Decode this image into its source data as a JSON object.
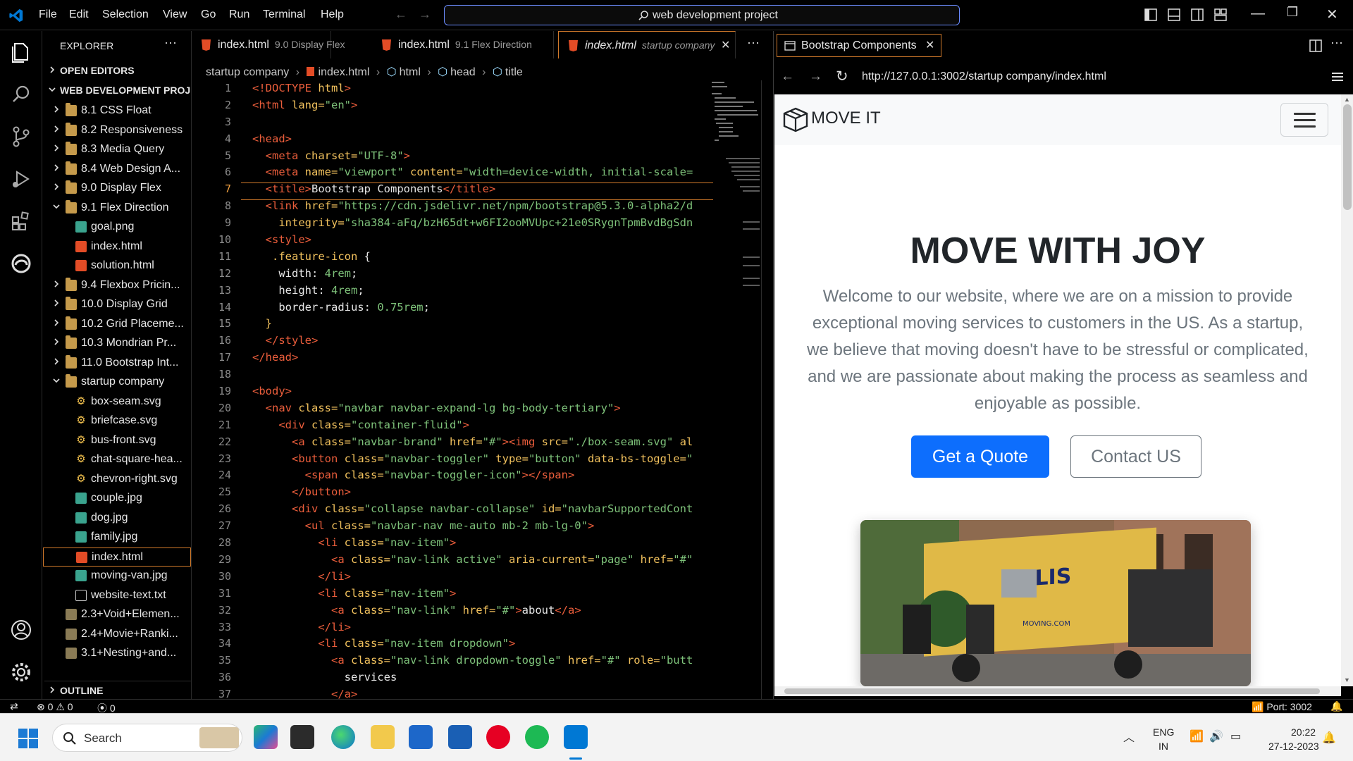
{
  "menu": [
    "File",
    "Edit",
    "Selection",
    "View",
    "Go",
    "Run",
    "Terminal",
    "Help"
  ],
  "search_box": "web development project",
  "explorer": {
    "title": "EXPLORER",
    "open_editors": "OPEN EDITORS",
    "workspace": "WEB DEVELOPMENT PROJ...",
    "outline": "OUTLINE",
    "items": [
      {
        "label": "8.1 CSS Float",
        "type": "folder",
        "state": "closed",
        "depth": 1
      },
      {
        "label": "8.2 Responsiveness",
        "type": "folder",
        "state": "closed",
        "depth": 1
      },
      {
        "label": "8.3 Media Query",
        "type": "folder",
        "state": "closed",
        "depth": 1
      },
      {
        "label": "8.4 Web Design A...",
        "type": "folder",
        "state": "closed",
        "depth": 1
      },
      {
        "label": "9.0 Display Flex",
        "type": "folder",
        "state": "closed",
        "depth": 1
      },
      {
        "label": "9.1 Flex Direction",
        "type": "folder",
        "state": "open",
        "depth": 1
      },
      {
        "label": "goal.png",
        "type": "image",
        "depth": 2
      },
      {
        "label": "index.html",
        "type": "html",
        "depth": 2
      },
      {
        "label": "solution.html",
        "type": "html",
        "depth": 2
      },
      {
        "label": "9.4 Flexbox Pricin...",
        "type": "folder",
        "state": "closed",
        "depth": 1
      },
      {
        "label": "10.0 Display Grid",
        "type": "folder",
        "state": "closed",
        "depth": 1
      },
      {
        "label": "10.2 Grid Placeme...",
        "type": "folder",
        "state": "closed",
        "depth": 1
      },
      {
        "label": "10.3 Mondrian Pr...",
        "type": "folder",
        "state": "closed",
        "depth": 1
      },
      {
        "label": "11.0 Bootstrap Int...",
        "type": "folder",
        "state": "closed",
        "depth": 1
      },
      {
        "label": "startup company",
        "type": "folder",
        "state": "open",
        "depth": 1
      },
      {
        "label": "box-seam.svg",
        "type": "svg",
        "depth": 2
      },
      {
        "label": "briefcase.svg",
        "type": "svg",
        "depth": 2
      },
      {
        "label": "bus-front.svg",
        "type": "svg",
        "depth": 2
      },
      {
        "label": "chat-square-hea...",
        "type": "svg",
        "depth": 2
      },
      {
        "label": "chevron-right.svg",
        "type": "svg",
        "depth": 2
      },
      {
        "label": "couple.jpg",
        "type": "image",
        "depth": 2
      },
      {
        "label": "dog.jpg",
        "type": "image",
        "depth": 2
      },
      {
        "label": "family.jpg",
        "type": "image",
        "depth": 2
      },
      {
        "label": "index.html",
        "type": "html",
        "depth": 2,
        "selected": true
      },
      {
        "label": "moving-van.jpg",
        "type": "image",
        "depth": 2
      },
      {
        "label": "website-text.txt",
        "type": "txt",
        "depth": 2
      },
      {
        "label": "2.3+Void+Elemen...",
        "type": "zip",
        "depth": 1
      },
      {
        "label": "2.4+Movie+Ranki...",
        "type": "zip",
        "depth": 1
      },
      {
        "label": "3.1+Nesting+and...",
        "type": "zip",
        "depth": 1
      }
    ]
  },
  "tabs": [
    {
      "name": "index.html",
      "desc": "9.0 Display Flex"
    },
    {
      "name": "index.html",
      "desc": "9.1 Flex Direction"
    },
    {
      "name": "index.html",
      "desc": "startup company",
      "active": true
    }
  ],
  "breadcrumb": [
    "startup company",
    "index.html",
    "html",
    "head",
    "title"
  ],
  "line_numbers": [
    "1",
    "2",
    "3",
    "4",
    "5",
    "6",
    "7",
    "8",
    "9",
    "10",
    "11",
    "12",
    "13",
    "14",
    "15",
    "16",
    "17",
    "18",
    "19",
    "20",
    "21",
    "22",
    "23",
    "24",
    "25",
    "26",
    "27",
    "28",
    "29",
    "30",
    "31",
    "32",
    "33",
    "34",
    "35",
    "36",
    "37"
  ],
  "code_lines": [
    [
      {
        "c": "t",
        "v": "<!DOCTYPE "
      },
      {
        "c": "a",
        "v": "html"
      },
      {
        "c": "t",
        "v": ">"
      }
    ],
    [
      {
        "c": "t",
        "v": "<html "
      },
      {
        "c": "a",
        "v": "lang="
      },
      {
        "c": "s",
        "v": "\"en\""
      },
      {
        "c": "t",
        "v": ">"
      }
    ],
    [],
    [
      {
        "c": "t",
        "v": "<head>"
      }
    ],
    [
      {
        "c": "n",
        "v": "  "
      },
      {
        "c": "t",
        "v": "<meta "
      },
      {
        "c": "a",
        "v": "charset="
      },
      {
        "c": "s",
        "v": "\"UTF-8\""
      },
      {
        "c": "t",
        "v": ">"
      }
    ],
    [
      {
        "c": "n",
        "v": "  "
      },
      {
        "c": "t",
        "v": "<meta "
      },
      {
        "c": "a",
        "v": "name="
      },
      {
        "c": "s",
        "v": "\"viewport\""
      },
      {
        "c": "a",
        "v": " content="
      },
      {
        "c": "s",
        "v": "\"width=device-width, initial-scale="
      }
    ],
    [
      {
        "c": "n",
        "v": "  "
      },
      {
        "c": "t",
        "v": "<title>"
      },
      {
        "c": "n",
        "v": "Bootstrap Components"
      },
      {
        "c": "t",
        "v": "</title>"
      }
    ],
    [
      {
        "c": "n",
        "v": "  "
      },
      {
        "c": "t",
        "v": "<link "
      },
      {
        "c": "a",
        "v": "href="
      },
      {
        "c": "s",
        "v": "\"https://cdn.jsdelivr.net/npm/bootstrap@5.3.0-alpha2/d"
      }
    ],
    [
      {
        "c": "n",
        "v": "    "
      },
      {
        "c": "a",
        "v": "integrity="
      },
      {
        "c": "s",
        "v": "\"sha384-aFq/bzH65dt+w6FI2ooMVUpc+21e0SRygnTpmBvdBgSdn"
      }
    ],
    [
      {
        "c": "n",
        "v": "  "
      },
      {
        "c": "t",
        "v": "<style>"
      }
    ],
    [
      {
        "c": "n",
        "v": "   "
      },
      {
        "c": "a",
        "v": ".feature-icon "
      },
      {
        "c": "n",
        "v": "{"
      }
    ],
    [
      {
        "c": "n",
        "v": "    width: "
      },
      {
        "c": "s",
        "v": "4rem"
      },
      {
        "c": "n",
        "v": ";"
      }
    ],
    [
      {
        "c": "n",
        "v": "    height: "
      },
      {
        "c": "s",
        "v": "4rem"
      },
      {
        "c": "n",
        "v": ";"
      }
    ],
    [
      {
        "c": "n",
        "v": "    border-radius: "
      },
      {
        "c": "s",
        "v": "0.75rem"
      },
      {
        "c": "n",
        "v": ";"
      }
    ],
    [
      {
        "c": "a",
        "v": "  }"
      }
    ],
    [
      {
        "c": "n",
        "v": "  "
      },
      {
        "c": "t",
        "v": "</style>"
      }
    ],
    [
      {
        "c": "t",
        "v": "</head>"
      }
    ],
    [],
    [
      {
        "c": "t",
        "v": "<body>"
      }
    ],
    [
      {
        "c": "n",
        "v": "  "
      },
      {
        "c": "t",
        "v": "<nav "
      },
      {
        "c": "a",
        "v": "class="
      },
      {
        "c": "s",
        "v": "\"navbar navbar-expand-lg bg-body-tertiary\""
      },
      {
        "c": "t",
        "v": ">"
      }
    ],
    [
      {
        "c": "n",
        "v": "    "
      },
      {
        "c": "t",
        "v": "<div "
      },
      {
        "c": "a",
        "v": "class="
      },
      {
        "c": "s",
        "v": "\"container-fluid\""
      },
      {
        "c": "t",
        "v": ">"
      }
    ],
    [
      {
        "c": "n",
        "v": "      "
      },
      {
        "c": "t",
        "v": "<a "
      },
      {
        "c": "a",
        "v": "class="
      },
      {
        "c": "s",
        "v": "\"navbar-brand\""
      },
      {
        "c": "a",
        "v": " href="
      },
      {
        "c": "s",
        "v": "\"#\""
      },
      {
        "c": "t",
        "v": "><img "
      },
      {
        "c": "a",
        "v": "src="
      },
      {
        "c": "s",
        "v": "\"./box-seam.svg\""
      },
      {
        "c": "a",
        "v": " al"
      }
    ],
    [
      {
        "c": "n",
        "v": "      "
      },
      {
        "c": "t",
        "v": "<button "
      },
      {
        "c": "a",
        "v": "class="
      },
      {
        "c": "s",
        "v": "\"navbar-toggler\""
      },
      {
        "c": "a",
        "v": " type="
      },
      {
        "c": "s",
        "v": "\"button\""
      },
      {
        "c": "a",
        "v": " data-bs-toggle="
      },
      {
        "c": "s",
        "v": "\""
      }
    ],
    [
      {
        "c": "n",
        "v": "        "
      },
      {
        "c": "t",
        "v": "<span "
      },
      {
        "c": "a",
        "v": "class="
      },
      {
        "c": "s",
        "v": "\"navbar-toggler-icon\""
      },
      {
        "c": "t",
        "v": "></span>"
      }
    ],
    [
      {
        "c": "n",
        "v": "      "
      },
      {
        "c": "t",
        "v": "</button>"
      }
    ],
    [
      {
        "c": "n",
        "v": "      "
      },
      {
        "c": "t",
        "v": "<div "
      },
      {
        "c": "a",
        "v": "class="
      },
      {
        "c": "s",
        "v": "\"collapse navbar-collapse\""
      },
      {
        "c": "a",
        "v": " id="
      },
      {
        "c": "s",
        "v": "\"navbarSupportedCont"
      }
    ],
    [
      {
        "c": "n",
        "v": "        "
      },
      {
        "c": "t",
        "v": "<ul "
      },
      {
        "c": "a",
        "v": "class="
      },
      {
        "c": "s",
        "v": "\"navbar-nav me-auto mb-2 mb-lg-0\""
      },
      {
        "c": "t",
        "v": ">"
      }
    ],
    [
      {
        "c": "n",
        "v": "          "
      },
      {
        "c": "t",
        "v": "<li "
      },
      {
        "c": "a",
        "v": "class="
      },
      {
        "c": "s",
        "v": "\"nav-item\""
      },
      {
        "c": "t",
        "v": ">"
      }
    ],
    [
      {
        "c": "n",
        "v": "            "
      },
      {
        "c": "t",
        "v": "<a "
      },
      {
        "c": "a",
        "v": "class="
      },
      {
        "c": "s",
        "v": "\"nav-link active\""
      },
      {
        "c": "a",
        "v": " aria-current="
      },
      {
        "c": "s",
        "v": "\"page\""
      },
      {
        "c": "a",
        "v": " href="
      },
      {
        "c": "s",
        "v": "\"#\""
      }
    ],
    [
      {
        "c": "n",
        "v": "          "
      },
      {
        "c": "t",
        "v": "</li>"
      }
    ],
    [
      {
        "c": "n",
        "v": "          "
      },
      {
        "c": "t",
        "v": "<li "
      },
      {
        "c": "a",
        "v": "class="
      },
      {
        "c": "s",
        "v": "\"nav-item\""
      },
      {
        "c": "t",
        "v": ">"
      }
    ],
    [
      {
        "c": "n",
        "v": "            "
      },
      {
        "c": "t",
        "v": "<a "
      },
      {
        "c": "a",
        "v": "class="
      },
      {
        "c": "s",
        "v": "\"nav-link\""
      },
      {
        "c": "a",
        "v": " href="
      },
      {
        "c": "s",
        "v": "\"#\""
      },
      {
        "c": "t",
        "v": ">"
      },
      {
        "c": "n",
        "v": "about"
      },
      {
        "c": "t",
        "v": "</a>"
      }
    ],
    [
      {
        "c": "n",
        "v": "          "
      },
      {
        "c": "t",
        "v": "</li>"
      }
    ],
    [
      {
        "c": "n",
        "v": "          "
      },
      {
        "c": "t",
        "v": "<li "
      },
      {
        "c": "a",
        "v": "class="
      },
      {
        "c": "s",
        "v": "\"nav-item dropdown\""
      },
      {
        "c": "t",
        "v": ">"
      }
    ],
    [
      {
        "c": "n",
        "v": "            "
      },
      {
        "c": "t",
        "v": "<a "
      },
      {
        "c": "a",
        "v": "class="
      },
      {
        "c": "s",
        "v": "\"nav-link dropdown-toggle\""
      },
      {
        "c": "a",
        "v": " href="
      },
      {
        "c": "s",
        "v": "\"#\""
      },
      {
        "c": "a",
        "v": " role="
      },
      {
        "c": "s",
        "v": "\"butt"
      }
    ],
    [
      {
        "c": "n",
        "v": "              services"
      }
    ],
    [
      {
        "c": "n",
        "v": "            "
      },
      {
        "c": "t",
        "v": "</a>"
      }
    ]
  ],
  "preview": {
    "tab_title": "Bootstrap Components",
    "url": "http://127.0.0.1:3002/startup company/index.html",
    "brand": "MOVE IT",
    "hero_title": "MOVE WITH JOY",
    "hero_text": "Welcome to our website, where we are on a mission to provide exceptional moving services to customers in the US. As a startup, we believe that moving doesn't have to be stressful or complicated, and we are passionate about making the process as seamless and enjoyable as possible.",
    "btn_primary": "Get a Quote",
    "btn_secondary": "Contact US",
    "truck_text": "POLIS",
    "truck_site": "MOVING.COM"
  },
  "status": {
    "errors": "0",
    "warnings": "0",
    "ports": "0",
    "port_label": "Port: 3002"
  },
  "taskbar": {
    "search": "Search",
    "lang": "ENG",
    "region": "IN",
    "time": "20:22",
    "date": "27-12-2023"
  },
  "colors": {
    "accent_blue": "#0d6efd",
    "vscode_blue": "#0078d4",
    "html_orange": "#e34c26",
    "active_tab_border": "#d17a2b"
  }
}
